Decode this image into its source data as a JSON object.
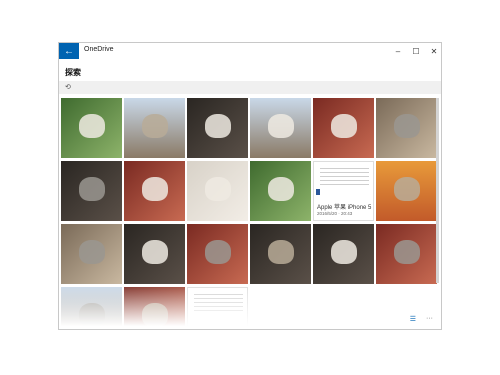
{
  "app": {
    "title": "OneDrive",
    "back_icon": "←",
    "minimize": "–",
    "maximize": "☐",
    "close": "✕"
  },
  "page": {
    "title": "探索",
    "toolbar_icon": "⟲"
  },
  "doc_tile": {
    "title": "Apple 苹果 iPhone 5",
    "date": "2016/5/20 · 20:43"
  },
  "bottom_bar": {
    "list_icon": "☰",
    "more_icon": "···"
  },
  "colors": {
    "accent": "#0063b1"
  }
}
